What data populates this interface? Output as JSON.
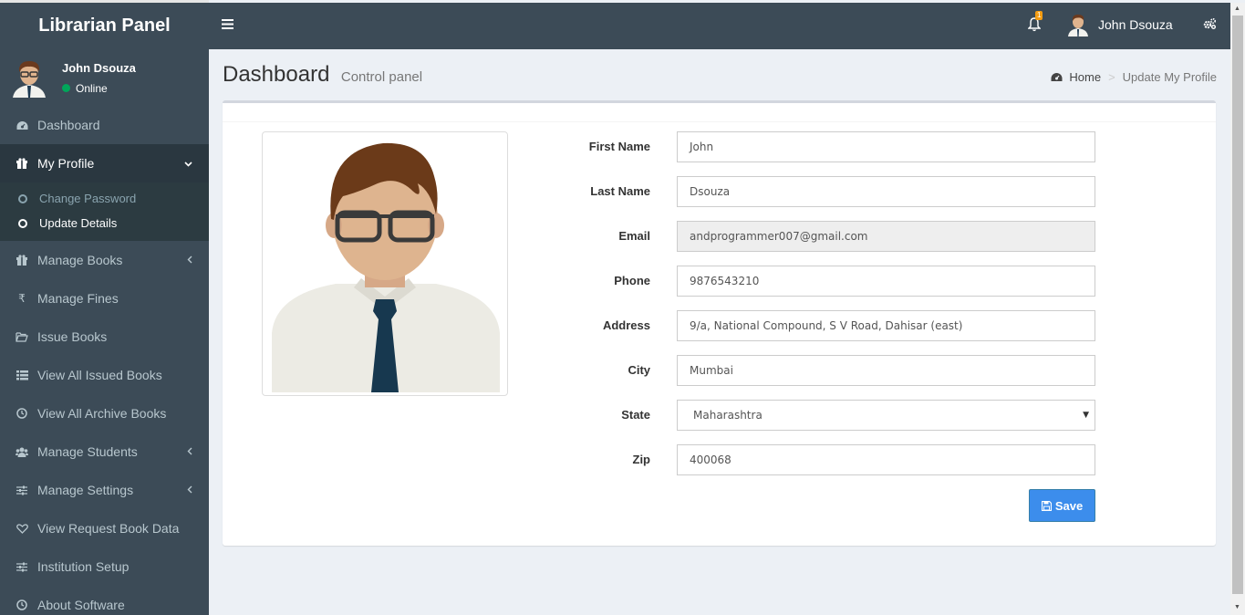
{
  "brand": "Librarian Panel",
  "user": {
    "name": "John Dsouza",
    "status": "Online"
  },
  "sidebar": {
    "items": [
      {
        "label": "Dashboard",
        "icon": "dashboard-icon"
      },
      {
        "label": "My Profile",
        "icon": "gift-icon"
      },
      {
        "label": "Manage Books",
        "icon": "gift-icon"
      },
      {
        "label": "Manage Fines",
        "icon": "rupee-icon"
      },
      {
        "label": "Issue Books",
        "icon": "folder-open-icon"
      },
      {
        "label": "View All Issued Books",
        "icon": "list-icon"
      },
      {
        "label": "View All Archive Books",
        "icon": "clock-icon"
      },
      {
        "label": "Manage Students",
        "icon": "users-icon"
      },
      {
        "label": "Manage Settings",
        "icon": "sliders-icon"
      },
      {
        "label": "View Request Book Data",
        "icon": "heart-icon"
      },
      {
        "label": "Institution Setup",
        "icon": "sliders-icon"
      },
      {
        "label": "About Software",
        "icon": "clock-icon"
      }
    ],
    "submenu": [
      {
        "label": "Change Password"
      },
      {
        "label": "Update Details"
      }
    ]
  },
  "header": {
    "notification_count": "1",
    "user_name": "John Dsouza"
  },
  "content": {
    "title": "Dashboard",
    "subtitle": "Control panel",
    "breadcrumb": {
      "home": "Home",
      "current": "Update My Profile"
    }
  },
  "form": {
    "first_name": {
      "label": "First Name",
      "value": "John"
    },
    "last_name": {
      "label": "Last Name",
      "value": "Dsouza"
    },
    "email": {
      "label": "Email",
      "value": "andprogrammer007@gmail.com"
    },
    "phone": {
      "label": "Phone",
      "value": "9876543210"
    },
    "address": {
      "label": "Address",
      "value": "9/a, National Compound, S V Road, Dahisar (east)"
    },
    "city": {
      "label": "City",
      "value": "Mumbai"
    },
    "state": {
      "label": "State",
      "value": "Maharashtra"
    },
    "zip": {
      "label": "Zip",
      "value": "400068"
    },
    "save_label": "Save"
  },
  "colors": {
    "sidebar": "#3c4b57",
    "accent": "#3c8dec",
    "online": "#00a65a"
  }
}
